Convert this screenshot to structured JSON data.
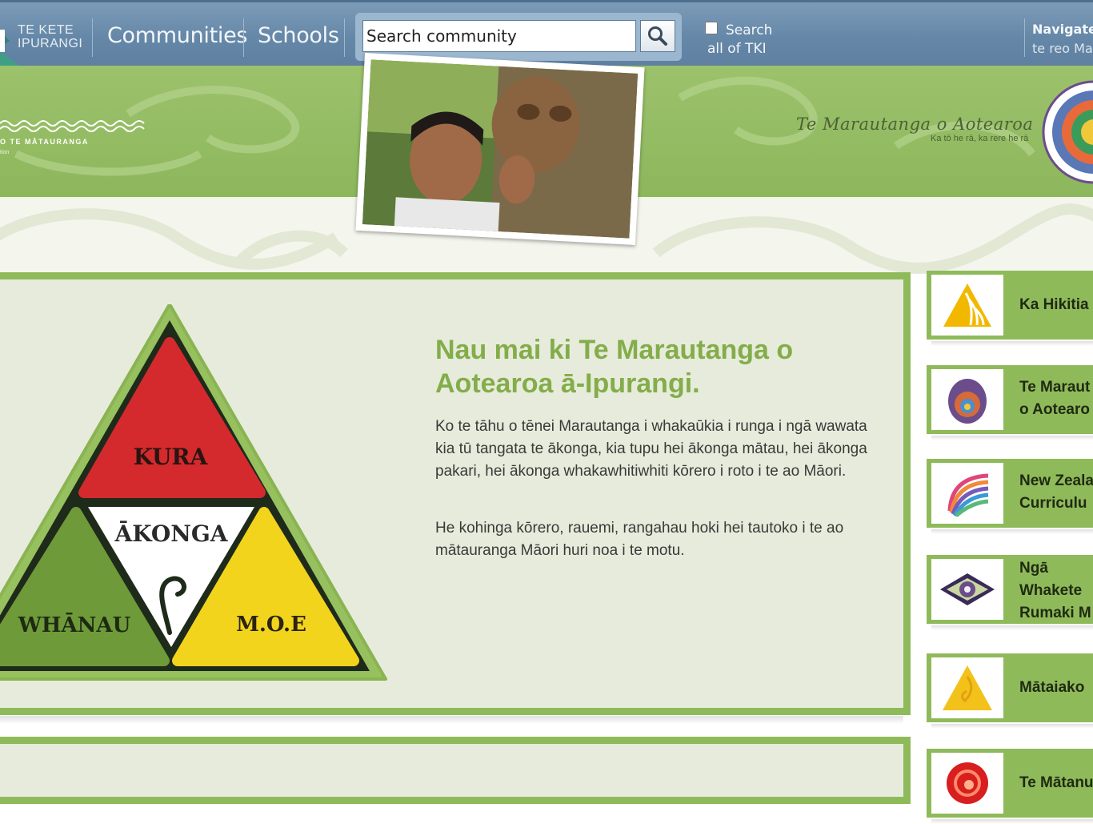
{
  "header": {
    "logo_line1": "TE KETE",
    "logo_line2": "IPURANGI",
    "nav": [
      "Communities",
      "Schools"
    ],
    "search_placeholder": "Search community",
    "search_all_label_line1": "Search",
    "search_all_label_line2": "all of TKI",
    "navigate_line1": "Navigate",
    "navigate_line2": "te reo Ma"
  },
  "banner": {
    "org_text": "O TE MĀTAURANGA",
    "org_sub": "tion",
    "script_title": "Te Marautanga o Aotearoa",
    "tagline": "Ka tō he rā, ka rere he rā"
  },
  "triangle": {
    "top": "KURA",
    "center": "ĀKONGA",
    "left": "WHĀNAU",
    "right": "M.O.E"
  },
  "welcome": {
    "title": "Nau mai ki Te Marautanga o Aotearoa ā-Ipurangi.",
    "paragraph1": "Ko te tāhu o tēnei Marautanga i whakaūkia i runga i ngā wawata kia tū tangata te ākonga, kia tupu hei ākonga mātau, hei ākonga pakari, hei ākonga whakawhitiwhiti kōrero i roto i te ao Māori.",
    "paragraph2": "He kohinga kōrero, rauemi, rangahau hoki hei tautoko i te ao mātauranga Māori huri noa i te motu."
  },
  "sidebar": {
    "items": [
      {
        "label_lines": [
          "Ka Hikitia"
        ],
        "icon": "yellow-triangle-icon"
      },
      {
        "label_lines": [
          "Te Maraut",
          "o Aotearo"
        ],
        "icon": "spiral-shell-icon"
      },
      {
        "label_lines": [
          "New Zeala",
          "Curriculu"
        ],
        "icon": "fan-curriculum-icon"
      },
      {
        "label_lines": [
          "Ngā",
          "Whakete",
          "Rumaki M"
        ],
        "icon": "eye-diamond-icon"
      },
      {
        "label_lines": [
          "Mātaiako"
        ],
        "icon": "mataiako-triangle-icon"
      },
      {
        "label_lines": [
          "Te Mātanu"
        ],
        "icon": "red-circle-icon"
      }
    ]
  },
  "colors": {
    "topbar": "#6688a8",
    "brand_green": "#8fba5a",
    "title_green": "#83ad4a",
    "panel_bg": "#e7ebdb",
    "kura_red": "#d9262f",
    "moe_yellow": "#f3d61c",
    "whanau_green": "#6d9a3a"
  }
}
